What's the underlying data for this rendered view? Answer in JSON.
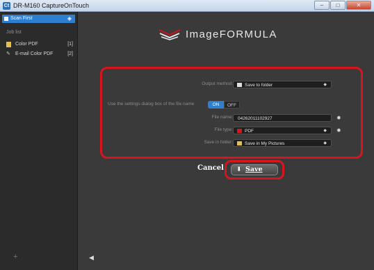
{
  "window": {
    "title": "DR-M160 CaptureOnTouch",
    "app_icon_glyph": "Ct",
    "controls": {
      "minimize": "–",
      "maximize": "□",
      "close": "✕"
    }
  },
  "sidebar": {
    "scan_first": "Scan First",
    "job_list_label": "Job list",
    "jobs": [
      {
        "name": "Color PDF",
        "number": "[1]",
        "icon": "pdf-icon"
      },
      {
        "name": "E-mail Color PDF",
        "number": "[2]",
        "icon": "paperclip-icon"
      }
    ],
    "add_glyph": "+"
  },
  "main": {
    "logo_text": "ImageFORMULA",
    "settings": {
      "output_method": {
        "label": "Output method:",
        "value": "Save to folder"
      },
      "use_settings_dialog": {
        "label": "Use the settings dialog box of the file name",
        "on": "ON",
        "off": "OFF"
      },
      "file_name": {
        "label": "File name:",
        "value": "04262011102927"
      },
      "file_type": {
        "label": "File type:",
        "value": "PDF"
      },
      "save_in_folder": {
        "label": "Save in folder:",
        "value": "Save in My Pictures"
      }
    },
    "buttons": {
      "cancel": "Cancel",
      "save": "Save"
    }
  },
  "colors": {
    "accent": "#2f7fd0",
    "highlight": "#d6161c",
    "background": "#3a3a3a"
  }
}
